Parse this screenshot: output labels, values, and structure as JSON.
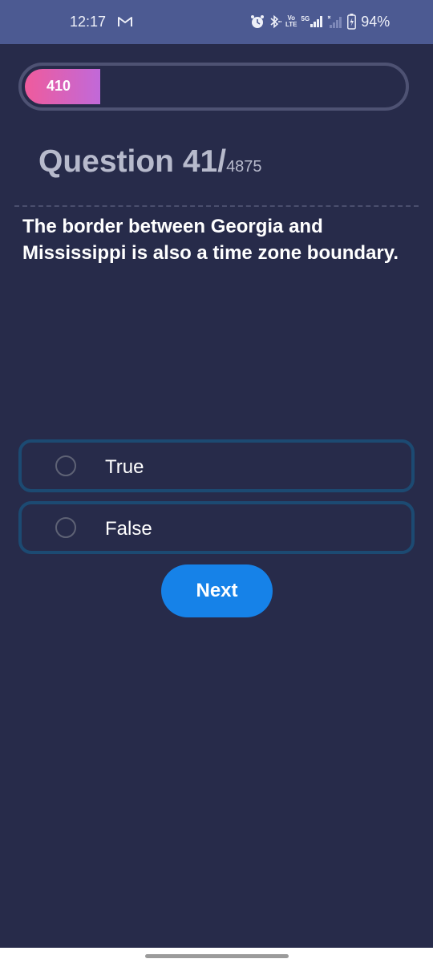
{
  "status_bar": {
    "time": "12:17",
    "network_label_top": "Vo",
    "network_label_bottom": "LTE",
    "signal_label": "5G",
    "battery": "94%"
  },
  "progress": {
    "label": "410",
    "fraction": 0.2
  },
  "question": {
    "prefix": "Question 41/",
    "total": "4875",
    "text": "The border between Georgia and Mississippi is also a time zone boundary."
  },
  "options": [
    {
      "label": "True",
      "selected": false
    },
    {
      "label": "False",
      "selected": false
    }
  ],
  "next_label": "Next",
  "colors": {
    "background": "#272b4a",
    "status_bar": "#4c5a92",
    "accent": "#1682e8",
    "progress_gradient_start": "#ef5b9c",
    "progress_gradient_end": "#c169d9",
    "option_border": "#1c4a72"
  }
}
